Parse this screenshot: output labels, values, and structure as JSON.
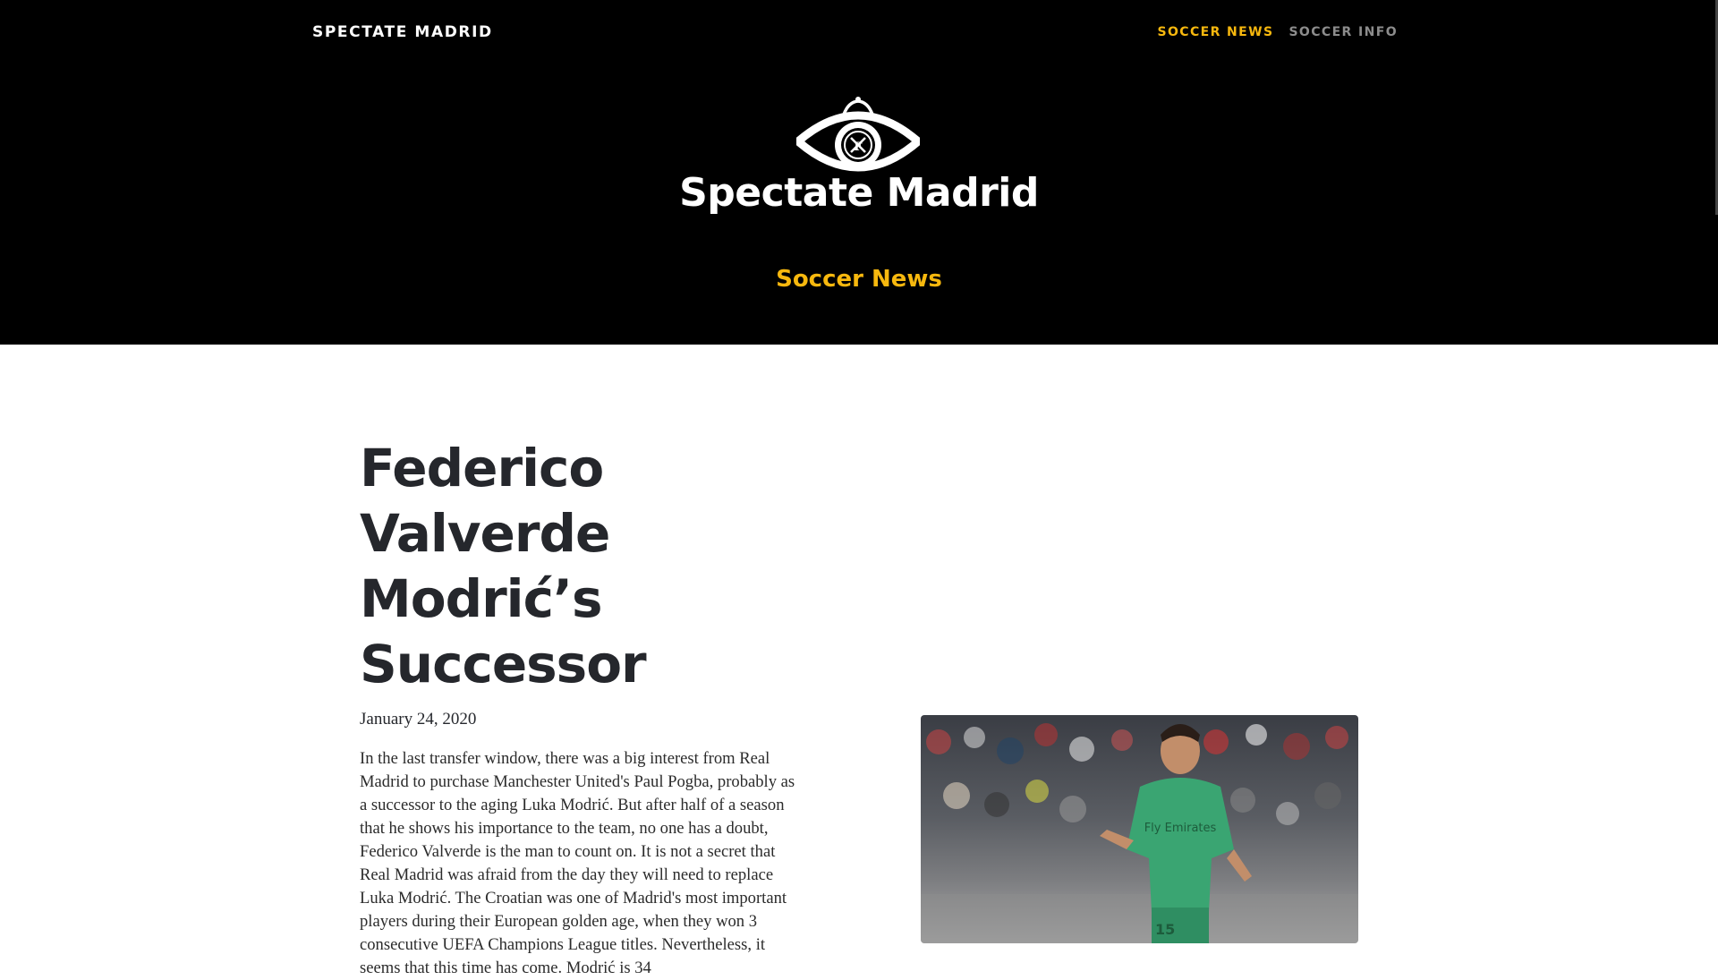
{
  "nav": {
    "brand": "SPECTATE MADRID",
    "links": [
      {
        "label": "SOCCER NEWS",
        "active": true
      },
      {
        "label": "SOCCER INFO",
        "active": false
      }
    ]
  },
  "hero": {
    "logo_icon": "crowned-eye-logo",
    "site_title": "Spectate Madrid",
    "section_label": "Soccer News"
  },
  "article": {
    "title": "Federico Valverde Modrić’s Successor",
    "date": "January 24, 2020",
    "body": "In the last transfer window, there was a big interest from Real Madrid to purchase Manchester United's Paul Pogba, probably as a successor to the aging Luka Modrić. But after half of a season that he shows his importance to the team, no one has a doubt, Federico Valverde is the man to count on. It is not a secret that Real Madrid was afraid from the day they will need to replace Luka Modrić. The Croatian was one of Madrid's most important players during their European golden age, when they won 3 consecutive UEFA Champions League titles. Nevertheless, it seems that this time has come. Modrić is 34",
    "image": {
      "shirt_text": "Fly Emirates",
      "shirt_number": "15"
    }
  },
  "colors": {
    "header_bg": "#000000",
    "accent": "#f7b80e",
    "inactive_link": "#8c8c8c",
    "text_dark": "#25272c"
  }
}
